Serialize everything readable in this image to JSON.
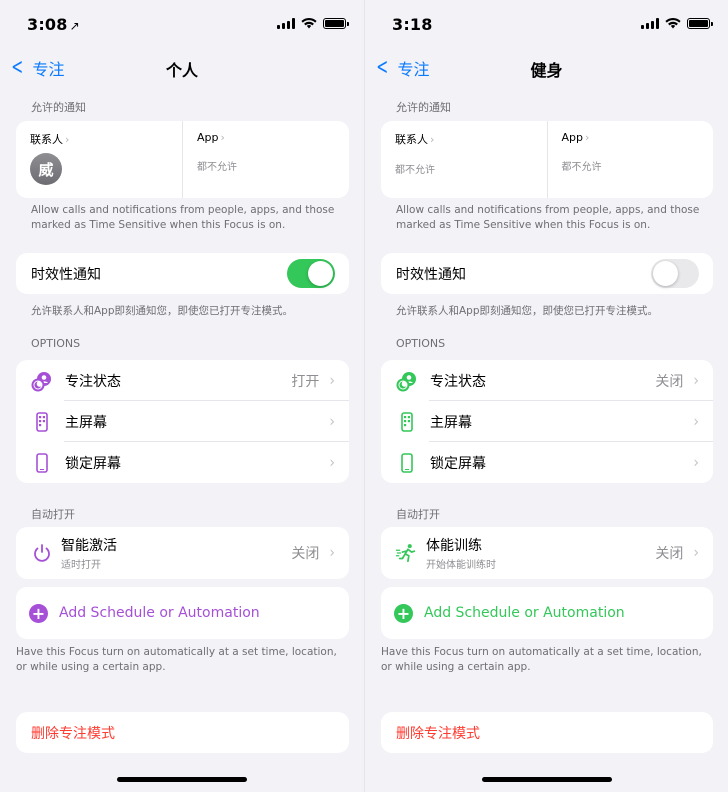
{
  "screens": [
    {
      "status_time": "3:08",
      "status_loc": "↗",
      "nav_back": "专注",
      "nav_title": "个人",
      "allowed_header": "允许的通知",
      "people_label": "联系人",
      "people_avatar": "威",
      "people_sub": "",
      "apps_label": "App",
      "apps_sub": "都不允许",
      "allowed_footnote": "Allow calls and notifications from people, apps, and those marked as Time Sensitive when this Focus is on.",
      "time_sensitive_label": "时效性通知",
      "time_sensitive_on": true,
      "time_sensitive_footnote": "允许联系人和App即刻通知您，即使您已打开专注模式。",
      "options_header": "OPTIONS",
      "focus_status_label": "专注状态",
      "focus_status_value": "打开",
      "home_screen_label": "主屏幕",
      "lock_screen_label": "锁定屏幕",
      "auto_header": "自动打开",
      "auto_title": "智能激活",
      "auto_subtitle": "适时打开",
      "auto_value": "关闭",
      "add_label": "Add Schedule or Automation",
      "auto_footnote": "Have this Focus turn on automatically at a set time, location, or while using a certain app.",
      "delete_label": "删除专注模式",
      "accent_color": "#a550d6"
    },
    {
      "status_time": "3:18",
      "status_loc": "",
      "nav_back": "专注",
      "nav_title": "健身",
      "allowed_header": "允许的通知",
      "people_label": "联系人",
      "people_avatar": "",
      "people_sub": "都不允许",
      "apps_label": "App",
      "apps_sub": "都不允许",
      "allowed_footnote": "Allow calls and notifications from people, apps, and those marked as Time Sensitive when this Focus is on.",
      "time_sensitive_label": "时效性通知",
      "time_sensitive_on": false,
      "time_sensitive_footnote": "允许联系人和App即刻通知您，即使您已打开专注模式。",
      "options_header": "OPTIONS",
      "focus_status_label": "专注状态",
      "focus_status_value": "关闭",
      "home_screen_label": "主屏幕",
      "lock_screen_label": "锁定屏幕",
      "auto_header": "自动打开",
      "auto_title": "体能训练",
      "auto_subtitle": "开始体能训练时",
      "auto_value": "关闭",
      "add_label": "Add Schedule or Automation",
      "auto_footnote": "Have this Focus turn on automatically at a set time, location, or while using a certain app.",
      "delete_label": "删除专注模式",
      "accent_color": "#34c759"
    }
  ]
}
